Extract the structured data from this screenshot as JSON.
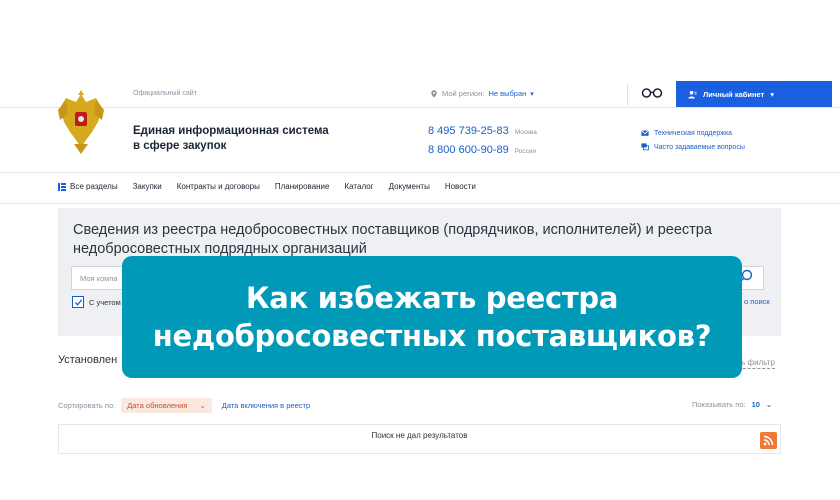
{
  "header": {
    "official_label": "Официальный сайт",
    "region_label": "Мой регион:",
    "region_value": "Не выбран",
    "cabinet_label": "Личный кабинет",
    "system_name_line1": "Единая информационная система",
    "system_name_line2": "в сфере закупок",
    "phones": [
      {
        "number": "8 495 739-25-83",
        "city": "Москва"
      },
      {
        "number": "8 800 600-90-89",
        "city": "Россия"
      }
    ],
    "support_links": [
      {
        "label": "Техническая поддержка",
        "icon": "envelope-icon"
      },
      {
        "label": "Часто задаваемые вопросы",
        "icon": "chat-icon"
      }
    ]
  },
  "nav": {
    "items": [
      "Все разделы",
      "Закупки",
      "Контракты и договоры",
      "Планирование",
      "Каталог",
      "Документы",
      "Новости"
    ]
  },
  "search": {
    "title": "Сведения из реестра недобросовестных поставщиков (подрядчиков, исполнителей) и реестра недобросовестных подрядных организаций",
    "placeholder": "Моя компа",
    "checkbox_label": "С учетом",
    "advanced_label": "о поиск"
  },
  "filters": {
    "title": "Установлен",
    "reset_label": "ить фильтр"
  },
  "sort": {
    "label": "Сортировать по:",
    "selected": "Дата обновления",
    "alternative": "Дата включения в реестр",
    "per_page_label": "Показывать по:",
    "per_page_value": "10"
  },
  "results": {
    "empty_text": "Поиск не дал результатов"
  },
  "banner": {
    "line1": "Как избежать реестра",
    "line2": "недобросовестных поставщиков?"
  },
  "colors": {
    "accent": "#1a5fe0",
    "banner": "#0099b8",
    "rss": "#f07a35"
  }
}
